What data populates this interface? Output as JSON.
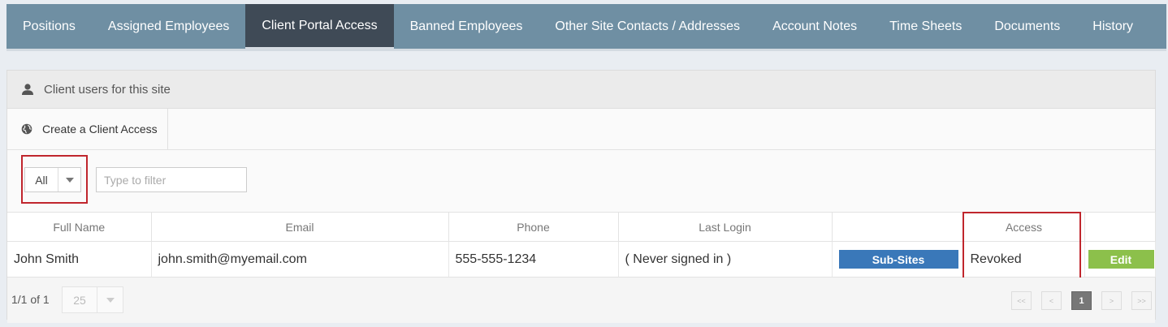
{
  "tabs": [
    {
      "label": "Positions"
    },
    {
      "label": "Assigned Employees"
    },
    {
      "label": "Client Portal Access"
    },
    {
      "label": "Banned Employees"
    },
    {
      "label": "Other Site Contacts / Addresses"
    },
    {
      "label": "Account Notes"
    },
    {
      "label": "Time Sheets"
    },
    {
      "label": "Documents"
    },
    {
      "label": "History"
    }
  ],
  "active_tab": "Client Portal Access",
  "panel": {
    "title": "Client users for this site",
    "create_label": "Create a Client Access"
  },
  "filter": {
    "selected": "All",
    "placeholder": "Type to filter"
  },
  "table": {
    "columns": [
      "Full Name",
      "Email",
      "Phone",
      "Last Login",
      "",
      "Access",
      ""
    ],
    "rows": [
      {
        "full_name": "John Smith",
        "email": "john.smith@myemail.com",
        "phone": "555-555-1234",
        "last_login": "( Never signed in )",
        "subsites_label": "Sub-Sites",
        "access": "Revoked",
        "edit_label": "Edit"
      }
    ]
  },
  "footer": {
    "page_count": "1/1 of 1",
    "page_size": "25",
    "pager": {
      "first": "<<",
      "prev": "<",
      "current": "1",
      "next": ">",
      "last": ">>"
    }
  },
  "colors": {
    "tabbar": "#6f8fa3",
    "active_tab": "#3f4a56",
    "subsites_button": "#3a78b9",
    "edit_button": "#8cc04b",
    "highlight_box": "#c0262d"
  },
  "icons": {
    "header": "user-icon",
    "create": "globe-icon",
    "dropdown": "caret-down-icon"
  }
}
